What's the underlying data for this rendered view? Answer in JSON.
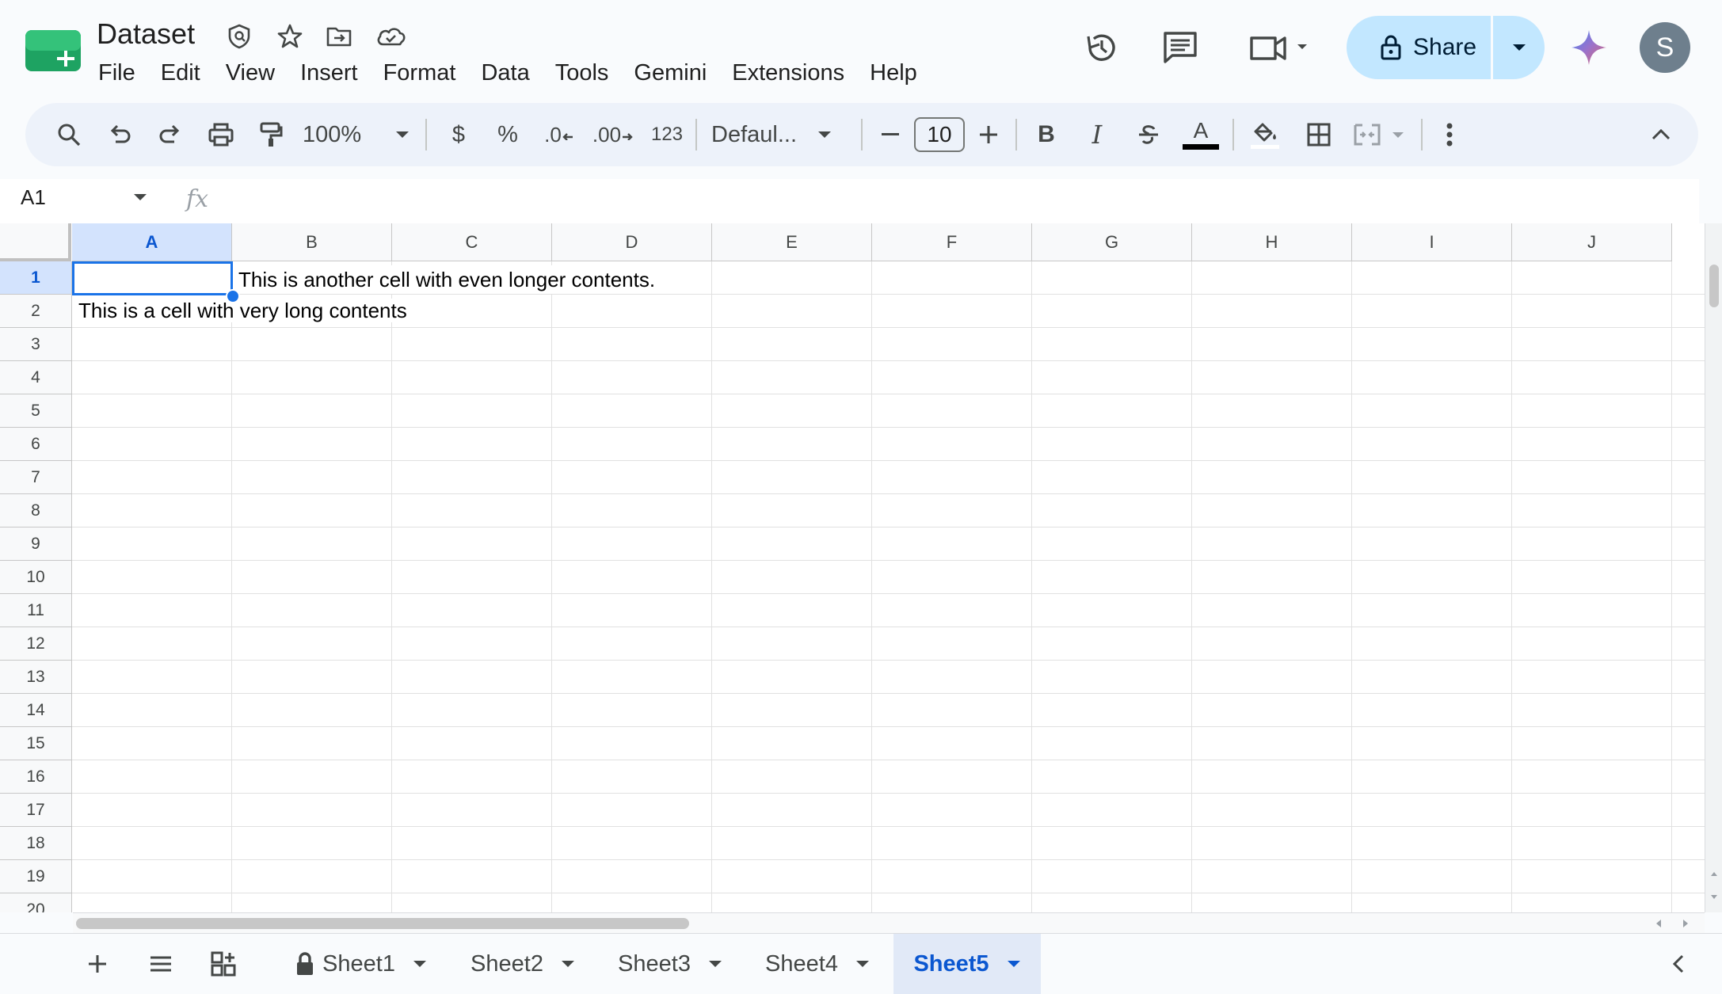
{
  "title_bar": {
    "doc_title": "Dataset",
    "icons": [
      "shield-icon",
      "star-icon",
      "move-to-folder-icon",
      "cloud-saved-icon"
    ]
  },
  "menu": [
    "File",
    "Edit",
    "View",
    "Insert",
    "Format",
    "Data",
    "Tools",
    "Gemini",
    "Extensions",
    "Help"
  ],
  "header_actions": {
    "share_label": "Share",
    "avatar_initial": "S",
    "icons": [
      "version-history-icon",
      "comments-icon",
      "meet-icon",
      "gemini-icon"
    ]
  },
  "toolbar": {
    "zoom": "100%",
    "currency": "$",
    "percent": "%",
    "decrease_decimal": ".0",
    "increase_decimal": ".00",
    "number_format": "123",
    "font": "Defaul...",
    "font_size": "10",
    "bold": "B",
    "italic": "I",
    "text_color_letter": "A",
    "text_color": "#000000"
  },
  "formula_bar": {
    "name_box": "A1",
    "fx": "fx",
    "value": ""
  },
  "grid": {
    "columns": [
      "A",
      "B",
      "C",
      "D",
      "E",
      "F",
      "G",
      "H",
      "I",
      "J"
    ],
    "rows": [
      "1",
      "2",
      "3",
      "4",
      "5",
      "6",
      "7",
      "8",
      "9",
      "10",
      "11",
      "12",
      "13",
      "14",
      "15",
      "16",
      "17",
      "18",
      "19",
      "20"
    ],
    "selected_cell": "A1",
    "cells": {
      "B1": "This is another cell with even longer contents.",
      "A2": "This is a cell with very long contents"
    }
  },
  "sheet_tabs": {
    "tabs": [
      {
        "label": "Sheet1",
        "locked": true
      },
      {
        "label": "Sheet2",
        "locked": false
      },
      {
        "label": "Sheet3",
        "locked": false
      },
      {
        "label": "Sheet4",
        "locked": false
      },
      {
        "label": "Sheet5",
        "locked": false
      }
    ],
    "active": "Sheet5"
  },
  "colors": {
    "accent": "#0b57d0",
    "share_bg": "#c2e7ff",
    "selection": "#1a73e8",
    "brand_green": "#34a853"
  }
}
